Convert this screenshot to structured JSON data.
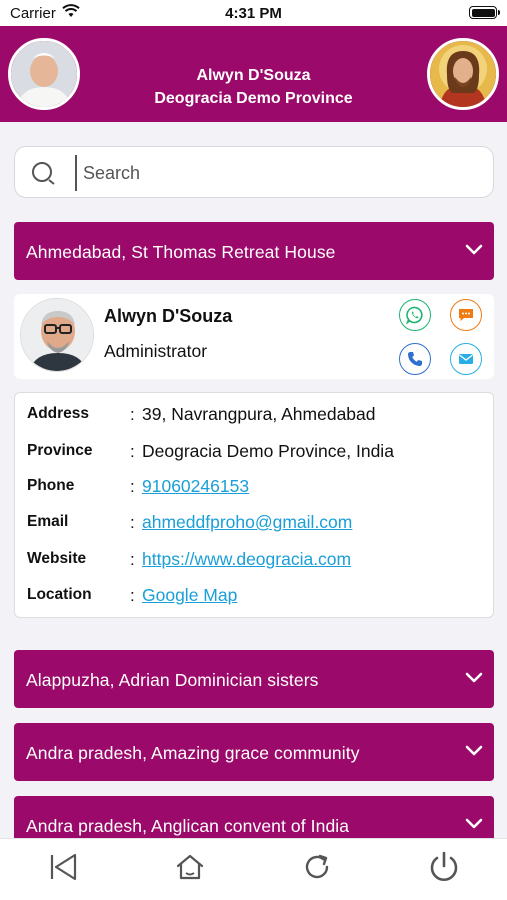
{
  "status_bar": {
    "carrier": "Carrier",
    "time": "4:31 PM"
  },
  "header": {
    "name": "Alwyn D'Souza",
    "province": "Deogracia Demo Province"
  },
  "search": {
    "placeholder": "Search"
  },
  "groups": [
    {
      "title": "Ahmedabad, St Thomas Retreat House",
      "expanded": true
    },
    {
      "title": "Alappuzha, Adrian Dominician sisters"
    },
    {
      "title": "Andra pradesh, Amazing grace community"
    },
    {
      "title": "Andra pradesh, Anglican convent of India"
    }
  ],
  "person": {
    "name": "Alwyn D'Souza",
    "role": "Administrator"
  },
  "details": {
    "address": {
      "label": "Address",
      "value": "39, Navrangpura, Ahmedabad"
    },
    "province": {
      "label": "Province",
      "value": "Deogracia Demo Province, India"
    },
    "phone": {
      "label": "Phone",
      "value": "91060246153"
    },
    "email": {
      "label": "Email",
      "value": "ahmeddfproho@gmail.com"
    },
    "website": {
      "label": "Website",
      "value": "https://www.deogracia.com"
    },
    "location": {
      "label": "Location",
      "value": "Google Map"
    }
  },
  "colors": {
    "brand": "#9b0a6a",
    "link": "#1a9fd8",
    "whatsapp": "#19b56f",
    "chat": "#f07a14",
    "call": "#2f6fd0",
    "mail": "#27aee4"
  },
  "icons": [
    "wifi-icon",
    "battery-icon",
    "search-icon",
    "chevron-down-icon",
    "whatsapp-icon",
    "chat-icon",
    "phone-icon",
    "mail-icon",
    "back-icon",
    "home-icon",
    "refresh-icon",
    "power-icon"
  ]
}
